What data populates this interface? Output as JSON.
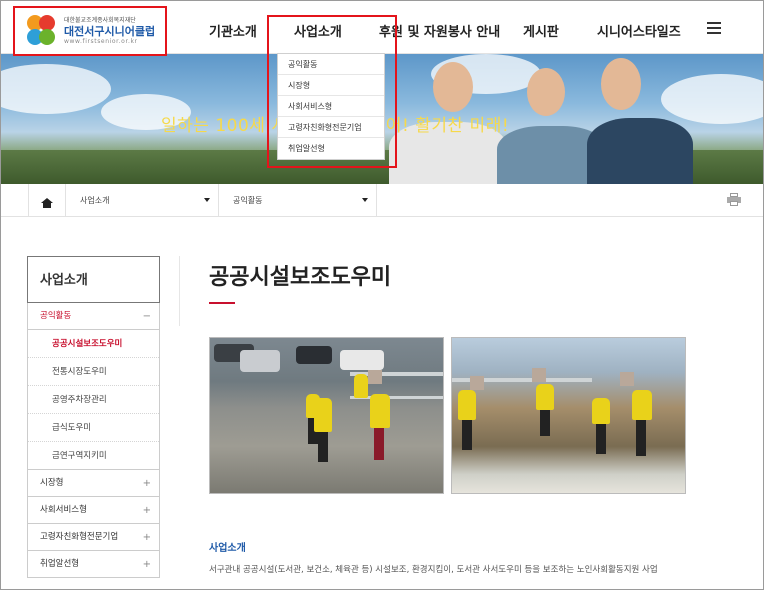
{
  "logo": {
    "subtitle": "대한불교조계종사회복지재단",
    "name": "대전서구시니어클럽",
    "url": "www.firstsenior.or.kr"
  },
  "gnb": {
    "items": [
      {
        "label": "기관소개"
      },
      {
        "label": "사업소개"
      },
      {
        "label": "후원 및 자원봉사 안내"
      },
      {
        "label": "게시판"
      },
      {
        "label": "시니어스타일즈"
      }
    ],
    "menu_icon": "hamburger-icon"
  },
  "dropdown": {
    "items": [
      "공익활동",
      "시장형",
      "사회서비스형",
      "고령자친화형전문기업",
      "취업알선형"
    ]
  },
  "hero": {
    "slogan": "일하는 100세 시대, 젊은 시니어! 활기찬 미래!"
  },
  "breadcrumb": {
    "home_icon": "home-icon",
    "level1": "사업소개",
    "level2": "공익활동",
    "print_icon": "printer-icon"
  },
  "sidebar": {
    "title": "사업소개",
    "groups": [
      {
        "label": "공익활동",
        "sign": "−",
        "active": true
      },
      {
        "label": "시장형",
        "sign": "+"
      },
      {
        "label": "사회서비스형",
        "sign": "+"
      },
      {
        "label": "고령자친화형전문기업",
        "sign": "+"
      },
      {
        "label": "취업알선형",
        "sign": "+"
      }
    ],
    "sub_items": [
      "공공시설보조도우미",
      "전통시장도우미",
      "공영주차장관리",
      "급식도우미",
      "금연구역지키미"
    ]
  },
  "content": {
    "title": "공공시설보조도우미",
    "section_title": "사업소개",
    "section_body": "서구관내 공공시설(도서관, 보건소, 체육관 등) 시설보조, 환경지킴이, 도서관 사서도우미 등을 보조하는 노인사회활동지원 사업"
  },
  "colors": {
    "accent_red": "#c8102e",
    "highlight_red": "#e4141b",
    "link_blue": "#1f5aa8",
    "slogan_yellow": "#f6d94b"
  }
}
